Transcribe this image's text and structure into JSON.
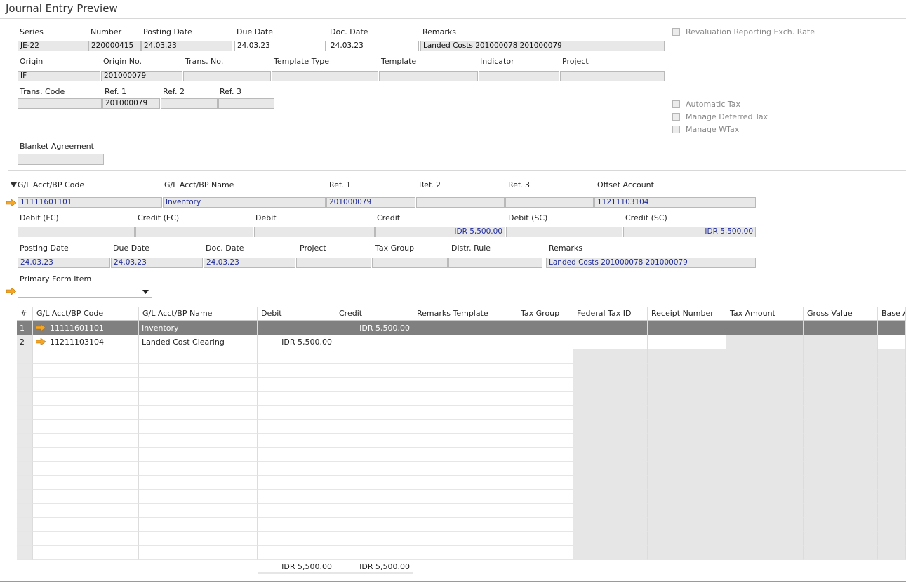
{
  "title": "Journal Entry Preview",
  "header": {
    "labels": {
      "series": "Series",
      "number": "Number",
      "posting_date": "Posting Date",
      "due_date": "Due Date",
      "doc_date": "Doc. Date",
      "remarks": "Remarks",
      "origin": "Origin",
      "origin_no": "Origin No.",
      "trans_no": "Trans. No.",
      "template_type": "Template Type",
      "template": "Template",
      "indicator": "Indicator",
      "project": "Project",
      "trans_code": "Trans. Code",
      "ref1": "Ref. 1",
      "ref2": "Ref. 2",
      "ref3": "Ref. 3",
      "blanket_agreement": "Blanket Agreement"
    },
    "values": {
      "series": "JE-22",
      "number": "220000415",
      "posting_date": "24.03.23",
      "due_date": "24.03.23",
      "doc_date": "24.03.23",
      "remarks": "Landed Costs 201000078 201000079",
      "origin": "IF",
      "origin_no": "201000079",
      "trans_no": "",
      "template_type": "",
      "template": "",
      "indicator": "",
      "project": "",
      "trans_code": "",
      "ref1": "201000079",
      "ref2": "",
      "ref3": "",
      "blanket_agreement": ""
    },
    "checkboxes": {
      "revaluation": "Revaluation Reporting Exch. Rate",
      "automatic_tax": "Automatic Tax",
      "manage_deferred_tax": "Manage Deferred Tax",
      "manage_wtax": "Manage WTax"
    }
  },
  "line": {
    "labels": {
      "gl_code": "G/L Acct/BP Code",
      "gl_name": "G/L Acct/BP Name",
      "ref1": "Ref. 1",
      "ref2": "Ref. 2",
      "ref3": "Ref. 3",
      "offset_account": "Offset Account",
      "debit_fc": "Debit (FC)",
      "credit_fc": "Credit (FC)",
      "debit": "Debit",
      "credit": "Credit",
      "debit_sc": "Debit (SC)",
      "credit_sc": "Credit (SC)",
      "posting_date": "Posting Date",
      "due_date": "Due Date",
      "doc_date": "Doc. Date",
      "project": "Project",
      "tax_group": "Tax Group",
      "distr_rule": "Distr. Rule",
      "remarks": "Remarks",
      "primary_form_item": "Primary Form Item"
    },
    "values": {
      "gl_code": "11111601101",
      "gl_name": "Inventory",
      "ref1": "201000079",
      "ref2": "",
      "ref3": "",
      "offset_account": "11211103104",
      "debit_fc": "",
      "credit_fc": "",
      "debit": "",
      "credit": "IDR 5,500.00",
      "debit_sc": "",
      "credit_sc": "IDR 5,500.00",
      "posting_date": "24.03.23",
      "due_date": "24.03.23",
      "doc_date": "24.03.23",
      "project": "",
      "tax_group": "",
      "distr_rule": "",
      "remarks": "Landed Costs 201000078 201000079",
      "primary_form_item": ""
    }
  },
  "table": {
    "columns": [
      "#",
      "G/L Acct/BP Code",
      "G/L Acct/BP Name",
      "Debit",
      "Credit",
      "Remarks Template",
      "Tax Group",
      "Federal Tax ID",
      "Receipt Number",
      "Tax Amount",
      "Gross Value",
      "Base A"
    ],
    "rows": [
      {
        "num": "1",
        "code": "11111601101",
        "name": "Inventory",
        "debit": "",
        "credit": "IDR 5,500.00"
      },
      {
        "num": "2",
        "code": "11211103104",
        "name": "Landed Cost Clearing",
        "debit": "IDR 5,500.00",
        "credit": ""
      }
    ],
    "totals": {
      "debit": "IDR 5,500.00",
      "credit": "IDR 5,500.00"
    }
  },
  "colors": {
    "selected_row": "#808080",
    "link_arrow": "#f5a623",
    "value_blue": "#1f2b9a"
  }
}
